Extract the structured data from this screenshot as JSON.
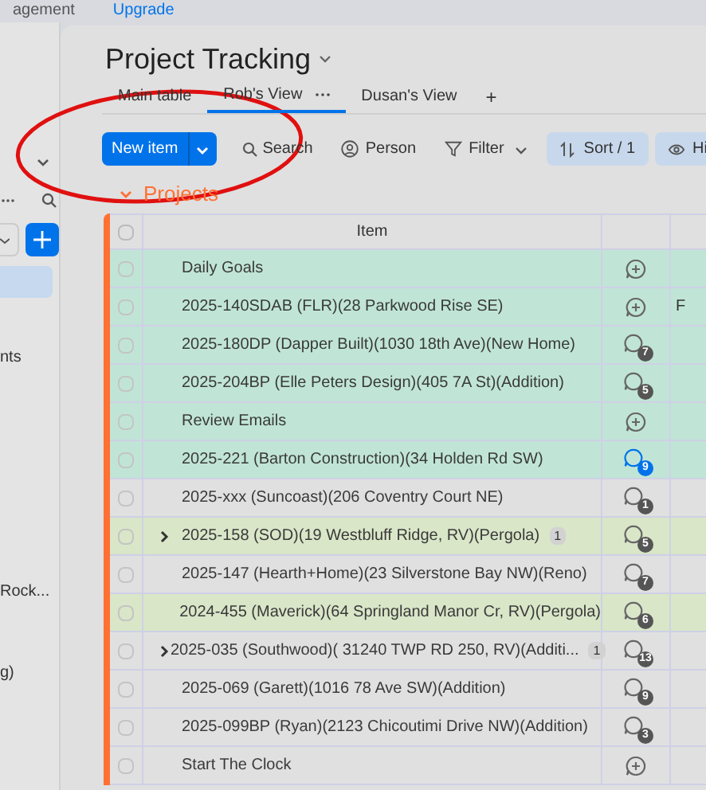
{
  "top_bar": {
    "left_text": "agement",
    "link": "Upgrade"
  },
  "sidebar": {
    "items": [
      {
        "label": "nts",
        "selected": false
      },
      {
        "label": "Rock...",
        "selected": false
      },
      {
        "label": "g)",
        "selected": false
      }
    ]
  },
  "board": {
    "title": "Project Tracking",
    "tabs": [
      {
        "label": "Main table",
        "selected": false,
        "menu": false
      },
      {
        "label": "Rob's View",
        "selected": true,
        "menu": true
      },
      {
        "label": "Dusan's View",
        "selected": false,
        "menu": false
      }
    ],
    "add_tab": "+",
    "toolbar": {
      "new_item": "New item",
      "search": "Search",
      "person": "Person",
      "filter": "Filter",
      "sort": "Sort / 1",
      "hide": "Hi"
    },
    "group": {
      "title": "Projects",
      "color": "#ff7033"
    },
    "table": {
      "select_all": {
        "checked": false
      },
      "columns": [
        "Item"
      ],
      "rows": [
        {
          "item": "Daily Goals",
          "color": "#c0e5d6",
          "expandable": false,
          "comments": {
            "kind": "add"
          }
        },
        {
          "item": "2025-140SDAB (FLR)(28 Parkwood Rise SE)",
          "color": "#c0e5d6",
          "expandable": false,
          "comments": {
            "kind": "add"
          },
          "column_3": "F"
        },
        {
          "item": "2025-180DP (Dapper Built)(1030 18th Ave)(New Home)",
          "color": "#c0e5d6",
          "expandable": false,
          "comments": {
            "kind": "count",
            "count": "7",
            "unread": false
          }
        },
        {
          "item": "2025-204BP (Elle Peters Design)(405 7A St)(Addition)",
          "color": "#c0e5d6",
          "expandable": false,
          "comments": {
            "kind": "count",
            "count": "5",
            "unread": false
          }
        },
        {
          "item": "Review Emails",
          "color": "#c0e5d6",
          "expandable": false,
          "comments": {
            "kind": "add"
          }
        },
        {
          "item": "2025-221 (Barton Construction)(34 Holden Rd SW)",
          "color": "#c0e5d6",
          "expandable": false,
          "comments": {
            "kind": "count",
            "count": "9",
            "unread": true
          }
        },
        {
          "item": "2025-xxx (Suncoast)(206 Coventry Court NE)",
          "color": "#e0e0e0",
          "expandable": false,
          "comments": {
            "kind": "count",
            "count": "1",
            "unread": false
          }
        },
        {
          "item": "2025-158 (SOD)(19 Westbluff Ridge, RV)(Pergola)",
          "color": "#d9e6c8",
          "expandable": true,
          "subitems": "1",
          "comments": {
            "kind": "count",
            "count": "5",
            "unread": false
          }
        },
        {
          "item": "2025-147 (Hearth+Home)(23 Silverstone Bay NW)(Reno)",
          "color": "#e0e0e0",
          "expandable": false,
          "comments": {
            "kind": "count",
            "count": "7",
            "unread": false
          }
        },
        {
          "item": "2024-455 (Maverick)(64 Springland Manor Cr, RV)(Pergola)",
          "color": "#d9e6c8",
          "expandable": false,
          "comments": {
            "kind": "count",
            "count": "6",
            "unread": false
          }
        },
        {
          "item": "2025-035 (Southwood)( 31240 TWP RD 250, RV)(Additi...",
          "color": "#e0e0e0",
          "expandable": true,
          "subitems": "1",
          "comments": {
            "kind": "count",
            "count": "13",
            "unread": false
          }
        },
        {
          "item": "2025-069 (Garett)(1016 78 Ave SW)(Addition)",
          "color": "#e0e0e0",
          "expandable": false,
          "comments": {
            "kind": "count",
            "count": "9",
            "unread": false
          }
        },
        {
          "item": "2025-099BP (Ryan)(2123 Chicoutimi Drive NW)(Addition)",
          "color": "#e0e0e0",
          "expandable": false,
          "comments": {
            "kind": "count",
            "count": "3",
            "unread": false
          }
        },
        {
          "item": "Start The Clock",
          "color": "#e0e0e0",
          "expandable": false,
          "comments": {
            "kind": "add"
          }
        }
      ]
    }
  }
}
